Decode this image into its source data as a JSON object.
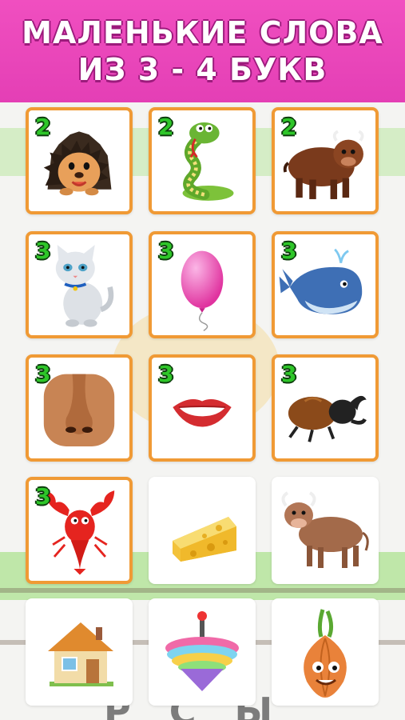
{
  "header": {
    "title_line1": "МАЛЕНЬКИЕ СЛОВА",
    "title_line2": "ИЗ 3 - 4  БУКВ"
  },
  "background": {
    "bottom_text": "Р  С Ы"
  },
  "cards": [
    {
      "picture": "hedgehog-icon",
      "badge": "2",
      "completed": true
    },
    {
      "picture": "snake-icon",
      "badge": "2",
      "completed": true
    },
    {
      "picture": "bison-icon",
      "badge": "2",
      "completed": true
    },
    {
      "picture": "cat-icon",
      "badge": "3",
      "completed": true
    },
    {
      "picture": "balloon-icon",
      "badge": "3",
      "completed": true
    },
    {
      "picture": "whale-icon",
      "badge": "3",
      "completed": true
    },
    {
      "picture": "nose-icon",
      "badge": "3",
      "completed": true
    },
    {
      "picture": "mouth-icon",
      "badge": "3",
      "completed": true
    },
    {
      "picture": "beetle-icon",
      "badge": "3",
      "completed": true
    },
    {
      "picture": "crayfish-icon",
      "badge": "3",
      "completed": true
    },
    {
      "picture": "cheese-icon",
      "badge": "",
      "completed": false
    },
    {
      "picture": "bull-icon",
      "badge": "",
      "completed": false
    },
    {
      "picture": "house-icon",
      "badge": "",
      "completed": false
    },
    {
      "picture": "spinning-top-icon",
      "badge": "",
      "completed": false
    },
    {
      "picture": "onion-icon",
      "badge": "",
      "completed": false
    }
  ]
}
